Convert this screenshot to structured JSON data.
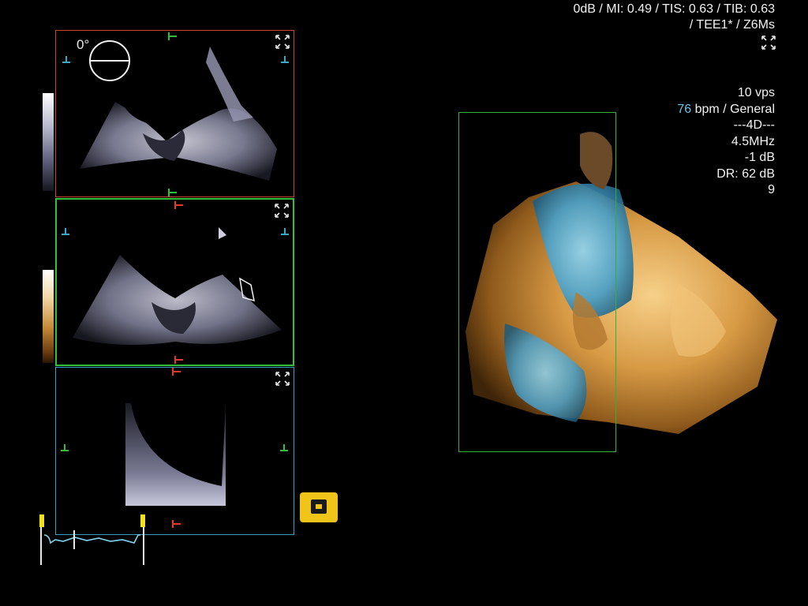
{
  "header": {
    "line1": "0dB / MI: 0.49 / TIS: 0.63 / TIB: 0.63",
    "line2": "/ TEE1* / Z6Ms"
  },
  "params": {
    "rate": "10 vps",
    "heart_rate_value": "76",
    "heart_rate_suffix": " bpm / General",
    "mode": "---4D---",
    "frequency": "4.5MHz",
    "gain": "-1 dB",
    "dynamic_range": "DR: 62 dB",
    "index": "9"
  },
  "panels": {
    "a": {
      "angle": "0°"
    }
  },
  "colors": {
    "panel_a_border": "#c24536",
    "panel_b_border": "#33c03a",
    "panel_c_border": "#3a9fbf",
    "heart_rate": "#6fc3ea",
    "logo": "#f0c419"
  },
  "icons": [
    "fullscreen-icon",
    "angle-dial-icon",
    "ecg-trace",
    "ultrasound-logo"
  ]
}
